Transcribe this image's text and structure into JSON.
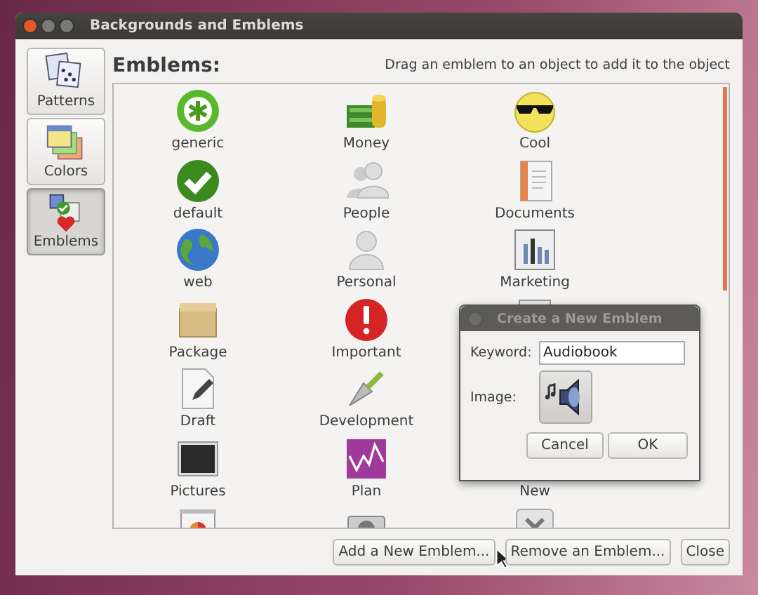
{
  "window": {
    "title": "Backgrounds and Emblems"
  },
  "sidebar": {
    "items": [
      {
        "label": "Patterns",
        "kind": "patterns",
        "selected": false
      },
      {
        "label": "Colors",
        "kind": "colors",
        "selected": false
      },
      {
        "label": "Emblems",
        "kind": "emblems",
        "selected": true
      }
    ]
  },
  "heading": "Emblems:",
  "hint": "Drag an emblem to an object to add it to the object",
  "emblem_rows": [
    [
      {
        "label": "generic",
        "kind": "generic"
      },
      {
        "label": "Money",
        "kind": "money"
      },
      {
        "label": "Cool",
        "kind": "cool"
      }
    ],
    [
      {
        "label": "default",
        "kind": "default"
      },
      {
        "label": "People",
        "kind": "people"
      },
      {
        "label": "Documents",
        "kind": "documents"
      }
    ],
    [
      {
        "label": "web",
        "kind": "web"
      },
      {
        "label": "Personal",
        "kind": "personal"
      },
      {
        "label": "Marketing",
        "kind": "marketing"
      }
    ],
    [
      {
        "label": "Package",
        "kind": "package"
      },
      {
        "label": "Important",
        "kind": "important"
      },
      {
        "kind": "window"
      }
    ],
    [
      {
        "label": "Draft",
        "kind": "draft"
      },
      {
        "label": "Development",
        "kind": "development"
      }
    ],
    [
      {
        "label": "Pictures",
        "kind": "pictures"
      },
      {
        "label": "Plan",
        "kind": "plan"
      },
      {
        "label": "New"
      }
    ],
    [
      {
        "kind": "presentation"
      },
      {
        "kind": "camera"
      },
      {
        "kind": "cross"
      }
    ]
  ],
  "buttons": [
    "Add a New Emblem...",
    "Remove an Emblem...",
    "Close"
  ],
  "dialog": {
    "title": "Create a New Emblem",
    "fields": [
      {
        "label": "Keyword:",
        "kind": "text",
        "value": "Audiobook"
      },
      {
        "label": "Image:",
        "kind": "image"
      }
    ],
    "buttons": [
      "Cancel",
      "OK"
    ]
  }
}
